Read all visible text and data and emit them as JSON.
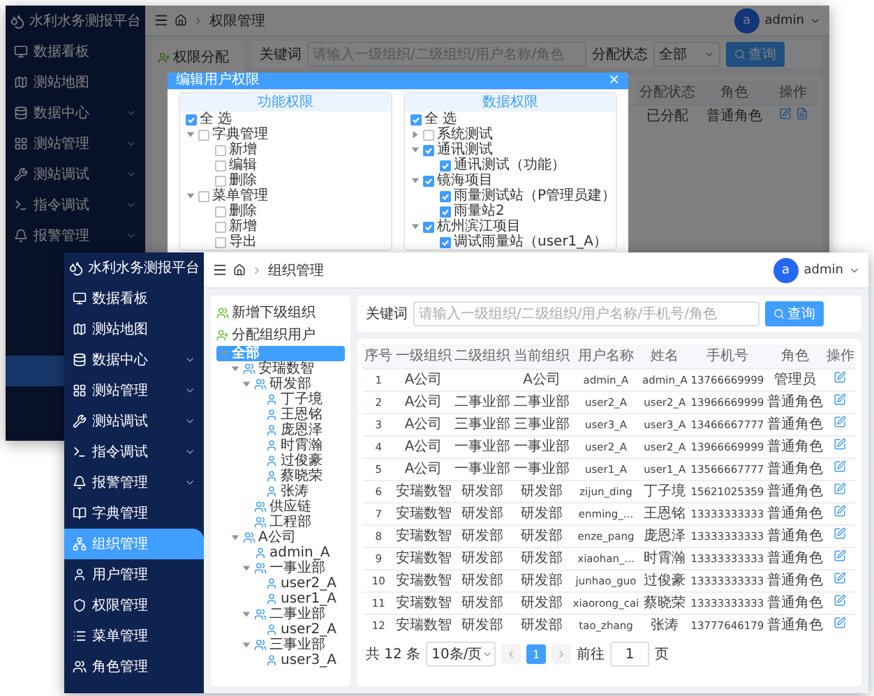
{
  "back_window": {
    "sidebar": {
      "title": "水利水务测报平台",
      "items": [
        {
          "label": "数据看板",
          "has_submenu": false
        },
        {
          "label": "测站地图",
          "has_submenu": false
        },
        {
          "label": "数据中心",
          "has_submenu": true
        },
        {
          "label": "测站管理",
          "has_submenu": true
        },
        {
          "label": "测站调试",
          "has_submenu": true
        },
        {
          "label": "指令调试",
          "has_submenu": true
        },
        {
          "label": "报警管理",
          "has_submenu": true
        }
      ]
    },
    "header": {
      "breadcrumb": "权限管理",
      "avatar": "a",
      "user": "admin"
    },
    "assign_button": "权限分配",
    "search": {
      "keyword_label": "关键词",
      "placeholder": "请输入一级组织/二级组织/用户名称/角色",
      "status_label": "分配状态",
      "status_value": "全部",
      "button": "查询"
    },
    "table": {
      "columns": [
        "分配状态",
        "角色",
        "操作"
      ],
      "rows": [
        {
          "status": "已分配",
          "role": "普通角色"
        }
      ]
    },
    "dialog": {
      "title": "编辑用户权限",
      "close": "×",
      "panels": [
        {
          "title": "功能权限",
          "nodes": [
            {
              "label": "全 选",
              "checked": true
            },
            {
              "label": "字典管理",
              "checked": false,
              "expanded": true,
              "children": [
                {
                  "label": "新增",
                  "checked": false
                },
                {
                  "label": "编辑",
                  "checked": false
                },
                {
                  "label": "删除",
                  "checked": false
                }
              ]
            },
            {
              "label": "菜单管理",
              "checked": false,
              "expanded": true,
              "children": [
                {
                  "label": "删除",
                  "checked": false
                },
                {
                  "label": "新增",
                  "checked": false
                },
                {
                  "label": "导出",
                  "checked": false
                }
              ]
            }
          ]
        },
        {
          "title": "数据权限",
          "nodes": [
            {
              "label": "全 选",
              "checked": true
            },
            {
              "label": "系统测试",
              "checked": false,
              "expanded": false
            },
            {
              "label": "通讯测试",
              "checked": true,
              "expanded": true,
              "children": [
                {
                  "label": "通讯测试（功能）",
                  "checked": true
                }
              ]
            },
            {
              "label": "镜海项目",
              "checked": true,
              "expanded": true,
              "children": [
                {
                  "label": "雨量测试站（P管理员建）",
                  "checked": true
                },
                {
                  "label": "雨量站2",
                  "checked": true
                }
              ]
            },
            {
              "label": "杭州滨江项目",
              "checked": true,
              "expanded": true,
              "children": [
                {
                  "label": "调试雨量站（user1_A）",
                  "checked": true
                }
              ]
            }
          ]
        }
      ]
    }
  },
  "front_window": {
    "sidebar": {
      "title": "水利水务测报平台",
      "items": [
        {
          "label": "数据看板",
          "has_submenu": false,
          "selected": false
        },
        {
          "label": "测站地图",
          "has_submenu": false,
          "selected": false
        },
        {
          "label": "数据中心",
          "has_submenu": true,
          "selected": false
        },
        {
          "label": "测站管理",
          "has_submenu": true,
          "selected": false
        },
        {
          "label": "测站调试",
          "has_submenu": true,
          "selected": false
        },
        {
          "label": "指令调试",
          "has_submenu": true,
          "selected": false
        },
        {
          "label": "报警管理",
          "has_submenu": true,
          "selected": false
        },
        {
          "label": "字典管理",
          "has_submenu": false,
          "selected": false
        },
        {
          "label": "组织管理",
          "has_submenu": false,
          "selected": true
        },
        {
          "label": "用户管理",
          "has_submenu": false,
          "selected": false
        },
        {
          "label": "权限管理",
          "has_submenu": false,
          "selected": false
        },
        {
          "label": "菜单管理",
          "has_submenu": false,
          "selected": false
        },
        {
          "label": "角色管理",
          "has_submenu": false,
          "selected": false
        }
      ]
    },
    "header": {
      "breadcrumb": "组织管理",
      "avatar": "a",
      "user": "admin"
    },
    "tree_buttons": [
      "新增下级组织",
      "分配组织用户"
    ],
    "tree": [
      {
        "label": "全部",
        "kind": "root",
        "selected": true,
        "expanded": true,
        "children": [
          {
            "label": "安瑞数智",
            "kind": "org",
            "selected": false,
            "expanded": true,
            "children": [
              {
                "label": "研发部",
                "kind": "org",
                "selected": false,
                "expanded": true,
                "children": [
                  {
                    "label": "丁子境",
                    "kind": "user",
                    "selected": false
                  },
                  {
                    "label": "王恩铭",
                    "kind": "user",
                    "selected": false
                  },
                  {
                    "label": "庞恩泽",
                    "kind": "user",
                    "selected": false
                  },
                  {
                    "label": "时霄瀚",
                    "kind": "user",
                    "selected": false
                  },
                  {
                    "label": "过俊豪",
                    "kind": "user",
                    "selected": false
                  },
                  {
                    "label": "蔡晓荣",
                    "kind": "user",
                    "selected": false
                  },
                  {
                    "label": "张涛",
                    "kind": "user",
                    "selected": false
                  }
                ]
              },
              {
                "label": "供应链",
                "kind": "org",
                "selected": false
              },
              {
                "label": "工程部",
                "kind": "org",
                "selected": false
              }
            ]
          },
          {
            "label": "A公司",
            "kind": "org",
            "selected": false,
            "expanded": true,
            "children": [
              {
                "label": "admin_A",
                "kind": "user",
                "selected": false
              },
              {
                "label": "一事业部",
                "kind": "org",
                "selected": false,
                "expanded": true,
                "children": [
                  {
                    "label": "user2_A",
                    "kind": "user",
                    "selected": false
                  },
                  {
                    "label": "user1_A",
                    "kind": "user",
                    "selected": false
                  }
                ]
              },
              {
                "label": "二事业部",
                "kind": "org",
                "selected": false,
                "expanded": true,
                "children": [
                  {
                    "label": "user2_A",
                    "kind": "user",
                    "selected": false
                  }
                ]
              },
              {
                "label": "三事业部",
                "kind": "org",
                "selected": false,
                "expanded": true,
                "children": [
                  {
                    "label": "user3_A",
                    "kind": "user",
                    "selected": false
                  }
                ]
              }
            ]
          }
        ]
      }
    ],
    "search": {
      "keyword_label": "关键词",
      "placeholder": "请输入一级组织/二级组织/用户名称/手机号/角色",
      "button": "查询"
    },
    "table": {
      "columns": [
        "序号",
        "一级组织",
        "二级组织",
        "当前组织",
        "用户名称",
        "姓名",
        "手机号",
        "角色",
        "操作"
      ],
      "rows": [
        [
          "1",
          "A公司",
          "",
          "A公司",
          "admin_A",
          "admin_A",
          "13766669999",
          "管理员"
        ],
        [
          "2",
          "A公司",
          "二事业部",
          "二事业部",
          "user2_A",
          "user2_A",
          "13966669999",
          "普通角色"
        ],
        [
          "3",
          "A公司",
          "三事业部",
          "三事业部",
          "user3_A",
          "user3_A",
          "13466667777",
          "普通角色"
        ],
        [
          "4",
          "A公司",
          "一事业部",
          "一事业部",
          "user2_A",
          "user2_A",
          "13966669999",
          "普通角色"
        ],
        [
          "5",
          "A公司",
          "一事业部",
          "一事业部",
          "user1_A",
          "user1_A",
          "13566667777",
          "普通角色"
        ],
        [
          "6",
          "安瑞数智",
          "研发部",
          "研发部",
          "zijun_ding",
          "丁子境",
          "15621025359",
          "普通角色"
        ],
        [
          "7",
          "安瑞数智",
          "研发部",
          "研发部",
          "enming_...",
          "王恩铭",
          "13333333333",
          "普通角色"
        ],
        [
          "8",
          "安瑞数智",
          "研发部",
          "研发部",
          "enze_pang",
          "庞恩泽",
          "13333333333",
          "普通角色"
        ],
        [
          "9",
          "安瑞数智",
          "研发部",
          "研发部",
          "xiaohan_...",
          "时霄瀚",
          "13333333333",
          "普通角色"
        ],
        [
          "10",
          "安瑞数智",
          "研发部",
          "研发部",
          "junhao_guo",
          "过俊豪",
          "13333333333",
          "普通角色"
        ],
        [
          "11",
          "安瑞数智",
          "研发部",
          "研发部",
          "xiaorong_cai",
          "蔡晓荣",
          "13333333333",
          "普通角色"
        ],
        [
          "12",
          "安瑞数智",
          "研发部",
          "研发部",
          "tao_zhang",
          "张涛",
          "13777646179",
          "普通角色"
        ]
      ]
    },
    "pagination": {
      "total": "共 12 条",
      "page_size": "10条/页",
      "pages": [
        {
          "label": "1",
          "selected": true
        }
      ],
      "goto_label": "前往",
      "goto_value": "1",
      "goto_suffix": "页"
    }
  }
}
